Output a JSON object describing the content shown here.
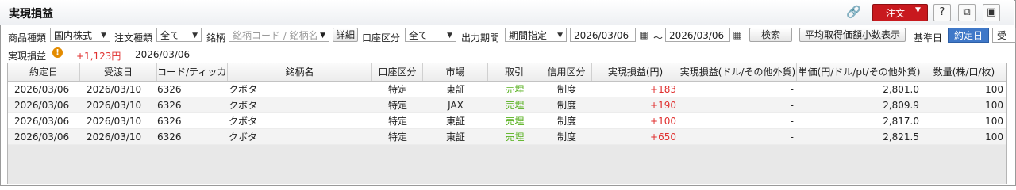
{
  "window": {
    "title": "実現損益"
  },
  "toolbar": {
    "order_label": "注文",
    "help_label": "?"
  },
  "filters": {
    "product_type_label": "商品種類",
    "product_type_value": "国内株式",
    "order_type_label": "注文種類",
    "order_type_value": "全て",
    "symbol_label": "銘柄",
    "symbol_placeholder": "銘柄コード / 銘柄名",
    "detail_button": "詳細",
    "account_label": "口座区分",
    "account_value": "全て",
    "period_label": "出力期間",
    "period_value": "期間指定",
    "date_from": "2026/03/06",
    "range_sep": "〜",
    "date_to": "2026/03/06",
    "search_button": "検索",
    "avg_decimal_button": "平均取得価額小数表示",
    "base_date_label": "基準日",
    "base_date_options": [
      "約定日",
      "受"
    ]
  },
  "summary": {
    "label": "実現損益",
    "value": "+1,123円",
    "date": "2026/03/06"
  },
  "table": {
    "columns": [
      "約定日",
      "受渡日",
      "コード/ティッカー",
      "銘柄名",
      "口座区分",
      "市場",
      "取引",
      "信用区分",
      "実現損益(円)",
      "実現損益(ドル/その他外貨)",
      "単価(円/ドル/pt/その他外貨)",
      "数量(株/口/枚)"
    ],
    "rows": [
      [
        "2026/03/06",
        "2026/03/10",
        "6326",
        "クボタ",
        "特定",
        "東証",
        "売埋",
        "制度",
        "+183",
        "-",
        "2,801.0",
        "100"
      ],
      [
        "2026/03/06",
        "2026/03/10",
        "6326",
        "クボタ",
        "特定",
        "JAX",
        "売埋",
        "制度",
        "+190",
        "-",
        "2,809.9",
        "100"
      ],
      [
        "2026/03/06",
        "2026/03/10",
        "6326",
        "クボタ",
        "特定",
        "東証",
        "売埋",
        "制度",
        "+100",
        "-",
        "2,817.0",
        "100"
      ],
      [
        "2026/03/06",
        "2026/03/10",
        "6326",
        "クボタ",
        "特定",
        "東証",
        "売埋",
        "制度",
        "+650",
        "-",
        "2,821.5",
        "100"
      ]
    ]
  },
  "colors": {
    "accent": "#3f78c8",
    "order_red": "#c8191e",
    "profit_red": "#e0302f",
    "trade_green": "#56b01d"
  }
}
